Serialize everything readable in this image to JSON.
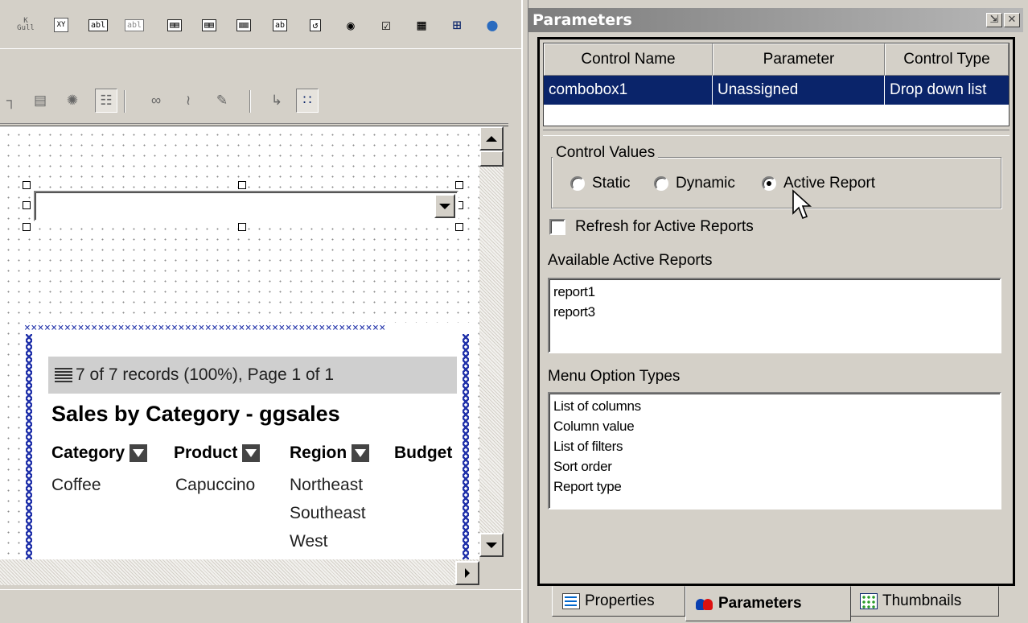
{
  "toolbar": {
    "buttons": [
      {
        "icon": "ruler-icon",
        "label": "K   "
      },
      {
        "icon": "xy-icon",
        "label": "XY"
      },
      {
        "icon": "textbox-icon",
        "label": "abl"
      },
      {
        "icon": "textbox-disabled-icon",
        "label": "abl"
      },
      {
        "icon": "list-add-icon",
        "label": "☰"
      },
      {
        "icon": "list-columns-icon",
        "label": "☷"
      },
      {
        "icon": "list-split-icon",
        "label": "☷"
      },
      {
        "icon": "button-control-icon",
        "label": "ab"
      },
      {
        "icon": "refresh-control-icon",
        "label": "↺"
      },
      {
        "icon": "radio-control-icon",
        "label": "◉"
      },
      {
        "icon": "checkbox-control-icon",
        "label": "☑"
      },
      {
        "icon": "grid-control-icon",
        "label": "▦"
      },
      {
        "icon": "tree-control-icon",
        "label": "⊞"
      },
      {
        "icon": "globe-icon",
        "label": "●"
      }
    ]
  },
  "toolbar2": {
    "buttons": [
      {
        "icon": "align-left-icon",
        "glyph": "┐"
      },
      {
        "icon": "align-bottom-icon",
        "glyph": "▄"
      },
      {
        "icon": "chain-icon",
        "glyph": "⚙"
      },
      {
        "icon": "arrange-icon",
        "glyph": "❖"
      },
      {
        "icon": "link-icon",
        "glyph": "∞"
      },
      {
        "icon": "unlink-icon",
        "glyph": "≀"
      },
      {
        "icon": "properties-icon",
        "glyph": "✎"
      },
      {
        "icon": "flow-icon",
        "glyph": "↳"
      },
      {
        "icon": "grid-snap-icon",
        "glyph": "∷"
      }
    ]
  },
  "report": {
    "record_status": "7 of 7 records (100%), Page 1 of 1",
    "title": "Sales by Category - ggsales",
    "columns": [
      "Category",
      "Product",
      "Region",
      "Budget"
    ],
    "rows": {
      "category": "Coffee",
      "product": "Capuccino",
      "regions": [
        "Northeast",
        "Southeast",
        "West"
      ]
    },
    "frame_pattern": "××××××××××××××××××××××××××××××××××××××××××××××××××××××"
  },
  "panel": {
    "title": "Parameters",
    "grid": {
      "headers": [
        "Control Name",
        "Parameter",
        "Control Type"
      ],
      "rows": [
        {
          "control_name": "combobox1",
          "parameter": "Unassigned",
          "control_type": "Drop down list"
        }
      ]
    },
    "control_values": {
      "legend": "Control Values",
      "options": [
        "Static",
        "Dynamic",
        "Active Report"
      ],
      "selected": "Active Report"
    },
    "refresh_label": "Refresh for Active Reports",
    "refresh_checked": false,
    "available_label": "Available Active Reports",
    "available_reports": [
      "report1",
      "report3"
    ],
    "menu_label": "Menu Option Types",
    "menu_options": [
      "List of columns",
      "Column value",
      "List of filters",
      "Sort order",
      "Report type"
    ]
  },
  "tabs": [
    {
      "label": "Properties",
      "icon": "properties-tab-icon",
      "active": false
    },
    {
      "label": "Parameters",
      "icon": "parameters-tab-icon",
      "active": true
    },
    {
      "label": "Thumbnails",
      "icon": "thumbnails-tab-icon",
      "active": false
    }
  ],
  "colors": {
    "selection": "#0a246a",
    "frame": "#2233aa",
    "titlebar": "#7c7c7c"
  }
}
